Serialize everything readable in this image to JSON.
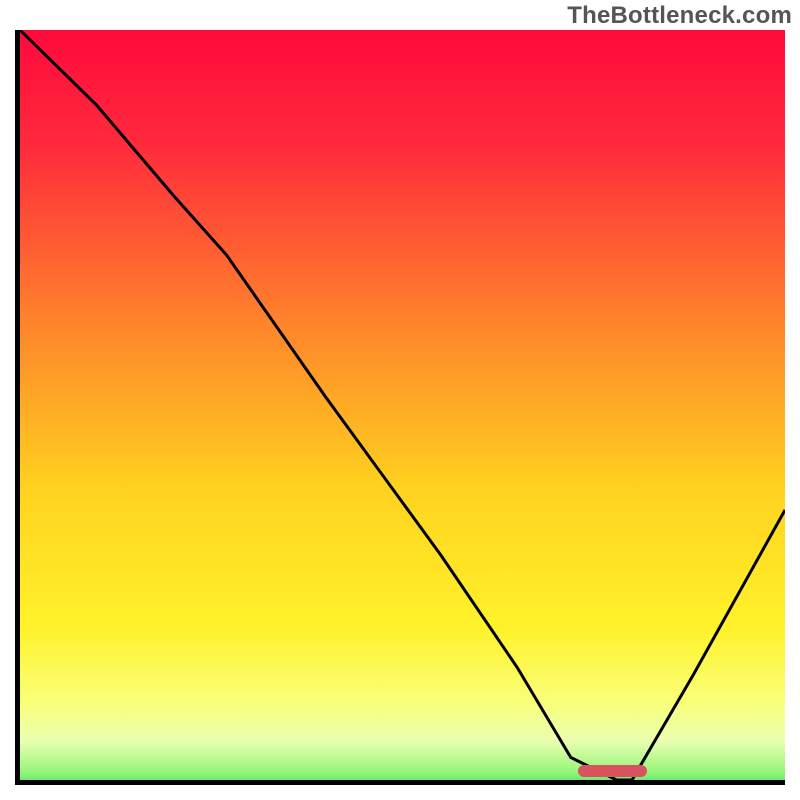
{
  "watermark": "TheBottleneck.com",
  "chart_data": {
    "type": "line",
    "title": "",
    "xlabel": "",
    "ylabel": "",
    "xlim": [
      0,
      100
    ],
    "ylim": [
      0,
      100
    ],
    "x": [
      0,
      10,
      20,
      27,
      40,
      55,
      65,
      72,
      78,
      80,
      88,
      100
    ],
    "values": [
      100,
      90,
      78,
      70,
      51,
      30,
      15,
      3,
      0,
      0,
      14,
      36
    ],
    "optimum_range_x": [
      73,
      82
    ],
    "gradient_stops": [
      {
        "pos": 0,
        "color": "#ff0a3c"
      },
      {
        "pos": 15,
        "color": "#ff2a3c"
      },
      {
        "pos": 40,
        "color": "#ff8a2a"
      },
      {
        "pos": 60,
        "color": "#ffd21f"
      },
      {
        "pos": 78,
        "color": "#fff22a"
      },
      {
        "pos": 88,
        "color": "#faff7a"
      },
      {
        "pos": 93,
        "color": "#e8ffb0"
      },
      {
        "pos": 97,
        "color": "#97f57a"
      },
      {
        "pos": 100,
        "color": "#20d65a"
      }
    ]
  }
}
